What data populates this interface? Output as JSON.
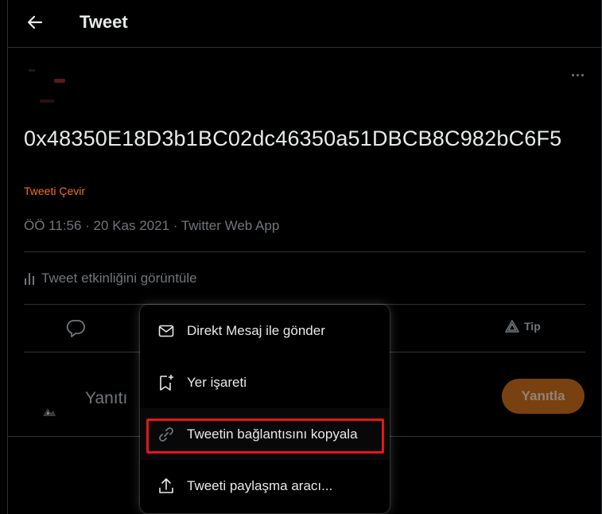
{
  "header": {
    "title": "Tweet",
    "back_icon": "arrow-left-icon"
  },
  "tweet": {
    "text": "0x48350E18D3b1BC02dc46350a51DBCB8C982bC6F5",
    "translate_label": "Tweeti Çevir",
    "meta": "ÖÖ 11:56 · 20 Kas 2021 · Twitter Web App",
    "analytics_label": "Tweet etkinliğini görüntüle"
  },
  "actions": {
    "tip_label": "Tip"
  },
  "reply": {
    "placeholder": "Yanıtı",
    "button_label": "Yanıtla"
  },
  "menu": {
    "items": [
      {
        "label": "Direkt Mesaj ile gönder",
        "icon": "envelope-icon"
      },
      {
        "label": "Yer işareti",
        "icon": "bookmark-add-icon"
      },
      {
        "label": "Tweetin bağlantısını kopyala",
        "icon": "link-icon",
        "highlighted": true
      },
      {
        "label": "Tweeti paylaşma aracı...",
        "icon": "share-icon"
      }
    ]
  },
  "colors": {
    "accent": "#f26f22",
    "highlight_border": "#e6151c",
    "reply_button": "#7a4110"
  }
}
